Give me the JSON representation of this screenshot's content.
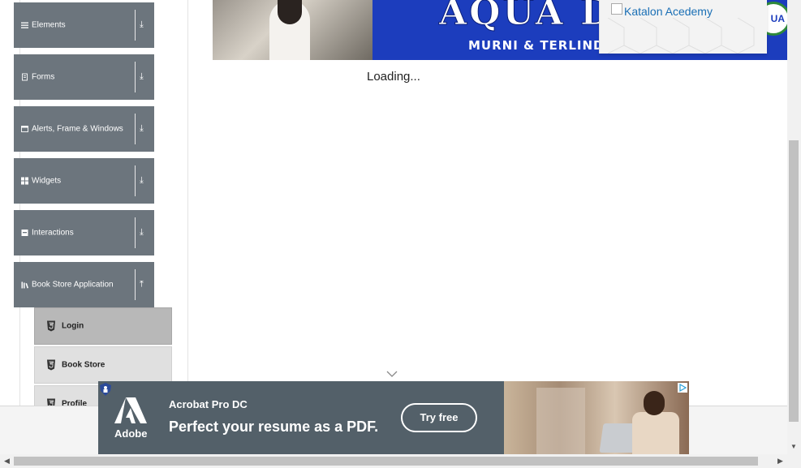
{
  "sidebar": {
    "groups": [
      {
        "label": "Elements",
        "icon": "hamburger-icon",
        "arrow": "⤓"
      },
      {
        "label": "Forms",
        "icon": "list-icon",
        "arrow": "⤓"
      },
      {
        "label": "Alerts, Frame & Windows",
        "icon": "window-icon",
        "arrow": "⤓"
      },
      {
        "label": "Widgets",
        "icon": "grid-icon",
        "arrow": "⤓"
      },
      {
        "label": "Interactions",
        "icon": "box-icon",
        "arrow": "⤓"
      },
      {
        "label": "Book Store Application",
        "icon": "book-icon",
        "arrow": "⤒"
      }
    ],
    "book_items": [
      {
        "label": "Login",
        "icon": "html5-icon"
      },
      {
        "label": "Book Store",
        "icon": "html5-icon"
      },
      {
        "label": "Profile",
        "icon": "html5-icon"
      }
    ]
  },
  "banner": {
    "brand_text": "AQUA DU",
    "tagline": "MURNI & TERLIND",
    "logo_text": "UA"
  },
  "katalon": {
    "alt_text": "Katalon Acedemy"
  },
  "main": {
    "loading_text": "Loading..."
  },
  "ad": {
    "brand": "Adobe",
    "product": "Acrobat Pro DC",
    "headline": "Perfect your resume as a PDF.",
    "cta_label": "Try free"
  },
  "colors": {
    "sidebar_group_bg": "#6c757d",
    "sidebar_active_bg": "#b8b8b8",
    "banner_blue": "#1c3dbd",
    "ad_bg": "#536069"
  }
}
